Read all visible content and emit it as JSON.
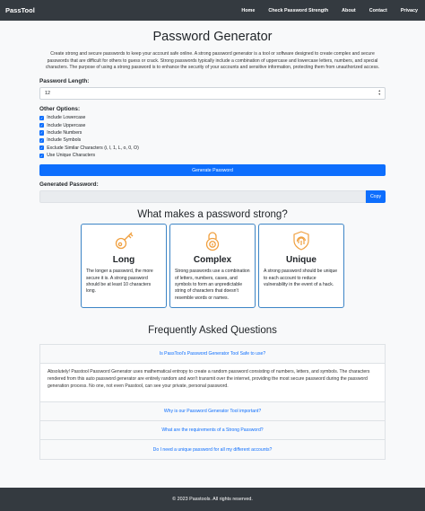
{
  "nav": {
    "brand": "PassTool",
    "links": [
      "Home",
      "Check Password Strength",
      "About",
      "Contact",
      "Privacy"
    ]
  },
  "main": {
    "title": "Password Generator",
    "intro": "Create strong and secure passwords to keep your account safe online. A strong password generator is a tool or software designed to create complex and secure passwords that are difficult for others to guess or crack. Strong passwords typically include a combination of uppercase and lowercase letters, numbers, and special characters. The purpose of using a strong password is to enhance the security of your accounts and sensitive information, protecting them from unauthorized access.",
    "length_label": "Password Length:",
    "length_value": "12",
    "options_label": "Other Options:",
    "options": [
      {
        "label": "Include Lowercase",
        "checked": true
      },
      {
        "label": "Include Uppercase",
        "checked": true
      },
      {
        "label": "Include Numbers",
        "checked": true
      },
      {
        "label": "Include Symbols",
        "checked": true
      },
      {
        "label": "Exclude Similar Characters (i, l, 1, L, o, 0, O)",
        "checked": true
      },
      {
        "label": "Use Unique Characters",
        "checked": true
      }
    ],
    "generate_button": "Generate Password",
    "generated_label": "Generated Password:",
    "generated_value": "",
    "copy_button": "Copy"
  },
  "strong": {
    "title": "What makes a password strong?",
    "cards": [
      {
        "icon": "key-icon",
        "title": "Long",
        "text": "The longer a password, the more secure it is. A strong password should be at least 10 characters long."
      },
      {
        "icon": "lock-icon",
        "title": "Complex",
        "text": "Strong passwords use a combination of letters, numbers, cases, and symbols to form an unpredictable string of characters that doesn't resemble words or names."
      },
      {
        "icon": "fingerprint-icon",
        "title": "Unique",
        "text": "A strong password should be unique to each account to reduce vulnerability in the event of a hack."
      }
    ]
  },
  "faq": {
    "title": "Frequently Asked Questions",
    "items": [
      {
        "q": "Is PassTool's Password Generator Tool Safe to use?",
        "a": "Absolutely! Passtool Password Generator uses mathematical entropy to create a random password consisting of numbers, letters, and symbols. The characters rendered from this auto password generator are entirely random and won't transmit over the internet, providing the most secure password during the password generation process. No one, not even Passtool, can see your private, personal password."
      },
      {
        "q": "Why is our Password Generator Tool important?"
      },
      {
        "q": "What are the requirements of a Strong Password?"
      },
      {
        "q": "Do I need a unique password for all my different accounts?"
      }
    ]
  },
  "footer": {
    "text": "© 2023 Passtools. All rights reserved."
  },
  "colors": {
    "accent": "#0d6efd",
    "icon": "#f0a040",
    "card_border": "#3d85c6",
    "navbar": "#343a40"
  }
}
